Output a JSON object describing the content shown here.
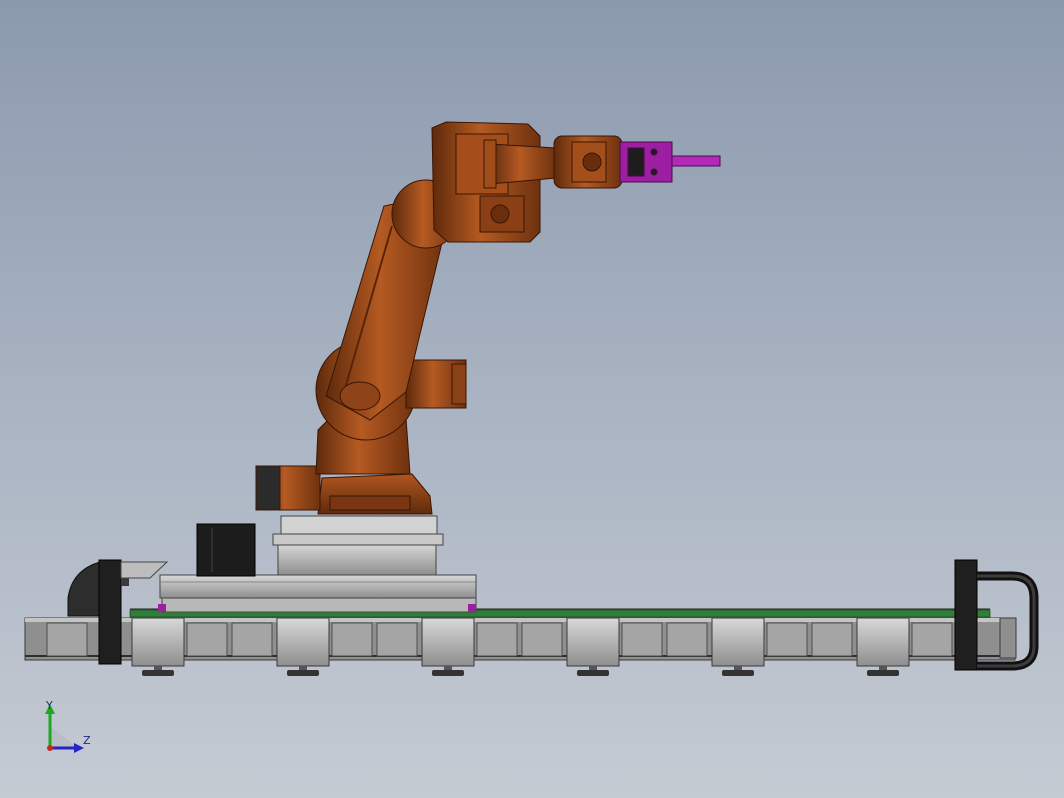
{
  "triad": {
    "y_label": "Y",
    "z_label": "Z"
  },
  "colors": {
    "robot": "#9a4a1c",
    "gripper": "#9b1fa0",
    "rail": "#9a9a9a",
    "cap": "#2a2a2a",
    "y_axis": "#1ea61e",
    "z_axis": "#2424c8"
  }
}
